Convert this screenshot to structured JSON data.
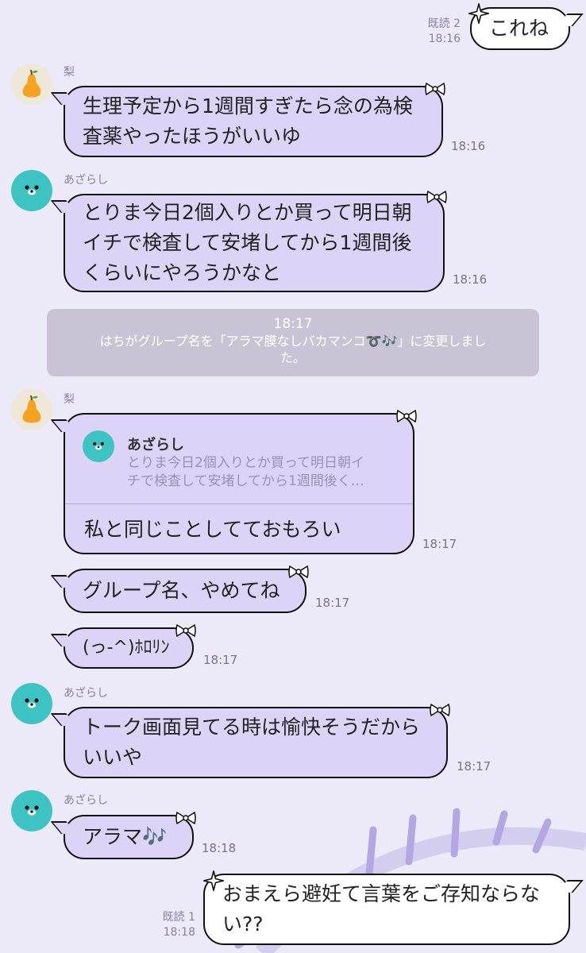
{
  "messages": {
    "m1": {
      "text": "これね",
      "read": "既読 2",
      "time": "18:16"
    },
    "m2": {
      "sender": "梨",
      "line1": "生理予定から1週間すぎたら念の為検",
      "line2": "査薬やったほうがいいゆ",
      "time": "18:16"
    },
    "m3": {
      "sender": "あざらし",
      "line1": "とりま今日2個入りとか買って明日朝",
      "line2": "イチで検査して安堵してから1週間後",
      "line3": "くらいにやろうかなと",
      "time": "18:16"
    },
    "system": {
      "time": "18:17",
      "line1": "はちがグループ名を「アラマ膜なしバカマンコ➰🎶」に変更しまし",
      "line2": "た。"
    },
    "m4": {
      "sender": "梨",
      "quote_name": "あざらし",
      "quote_line1": "とりま今日2個入りとか買って明日朝イ",
      "quote_line2": "チで検査して安堵してから1週間後く…",
      "text": "私と同じことしてておもろい",
      "time": "18:17"
    },
    "m5": {
      "text": "グループ名、やめてね",
      "time": "18:17"
    },
    "m6": {
      "text": "(っ-^)ﾎﾛﾘﾝ",
      "time": "18:17"
    },
    "m7": {
      "sender": "あざらし",
      "line1": "トーク画面見てる時は愉快そうだから",
      "line2": "いいや",
      "time": "18:17"
    },
    "m8": {
      "sender": "あざらし",
      "text": "アラマ🎶",
      "time": "18:18"
    },
    "m9": {
      "line1": "おまえら避妊て言葉をご存知ならな",
      "line2": "い??",
      "read": "既読 1",
      "time": "18:18"
    }
  },
  "icons": {
    "pear": "pear-avatar-icon",
    "seal": "seal-avatar-icon",
    "bow": "bow-icon",
    "sparkle": "sparkle-icon"
  },
  "colors": {
    "background": "#ece9f8",
    "bubble_in": "#dcd4f7",
    "bubble_out": "#ffffff",
    "avatar_seal": "#3ec3c3",
    "system_bg": "#c8c4d6"
  }
}
